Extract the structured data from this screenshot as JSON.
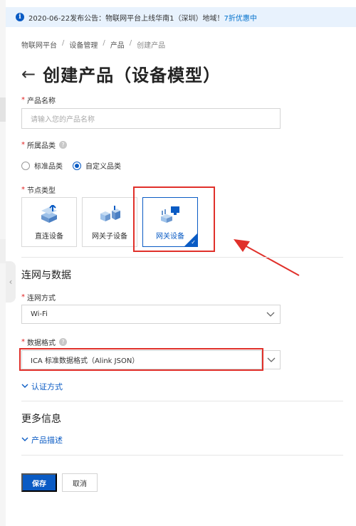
{
  "notice": {
    "icon": "info-icon",
    "text": "2020-06-22发布公告：物联网平台上线华南1（深圳）地域！",
    "link": "7折优惠中"
  },
  "breadcrumb": [
    "物联网平台",
    "设备管理",
    "产品",
    "创建产品"
  ],
  "page": {
    "back_icon": "←",
    "title": "创建产品（设备模型）"
  },
  "form": {
    "product_name": {
      "label": "产品名称",
      "placeholder": "请输入您的产品名称",
      "value": ""
    },
    "category": {
      "label": "所属品类",
      "options": [
        "标准品类",
        "自定义品类"
      ],
      "selected": "自定义品类"
    },
    "node_type": {
      "label": "节点类型",
      "options": [
        "直连设备",
        "网关子设备",
        "网关设备"
      ],
      "selected": "网关设备"
    },
    "network": {
      "section_title": "连网与数据",
      "connection_label": "连网方式",
      "connection_value": "Wi-Fi",
      "data_format_label": "数据格式",
      "data_format_value": "ICA 标准数据格式（Alink JSON）",
      "auth_toggle": "认证方式"
    },
    "more": {
      "section_title": "更多信息",
      "description_toggle": "产品描述"
    }
  },
  "actions": {
    "save": "保存",
    "cancel": "取消"
  },
  "colors": {
    "primary": "#0a5bc4",
    "annotation": "#e0302a",
    "notice_bg": "#e8f2fd"
  }
}
